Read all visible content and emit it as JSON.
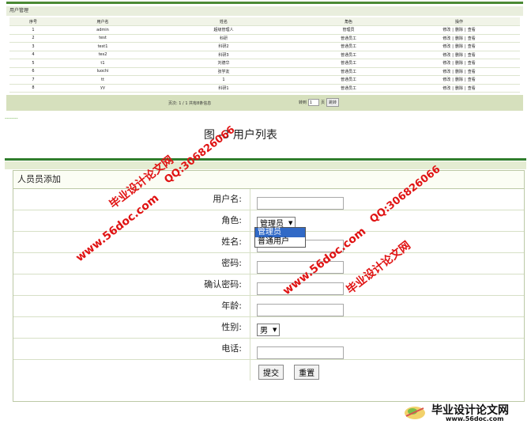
{
  "list": {
    "title": "用户管理",
    "columns": [
      "序号",
      "用户名",
      "姓名",
      "角色",
      "操作"
    ],
    "rows": [
      {
        "no": "1",
        "username": "admin",
        "name": "超级管理人",
        "role": "管理员",
        "ops": [
          "修改",
          "删除",
          "查看"
        ]
      },
      {
        "no": "2",
        "username": "test",
        "name": "科研",
        "role": "普通员工",
        "ops": [
          "修改",
          "删除",
          "查看"
        ]
      },
      {
        "no": "3",
        "username": "test1",
        "name": "科研2",
        "role": "普通员工",
        "ops": [
          "修改",
          "删除",
          "查看"
        ]
      },
      {
        "no": "4",
        "username": "tes2",
        "name": "科研3",
        "role": "普通员工",
        "ops": [
          "修改",
          "删除",
          "查看"
        ]
      },
      {
        "no": "5",
        "username": "t1",
        "name": "刘德华",
        "role": "普通员工",
        "ops": [
          "修改",
          "删除",
          "查看"
        ]
      },
      {
        "no": "6",
        "username": "Iuochi",
        "name": "张学友",
        "role": "普通员工",
        "ops": [
          "修改",
          "删除",
          "查看"
        ]
      },
      {
        "no": "7",
        "username": "tt",
        "name": "1",
        "role": "普通员工",
        "ops": [
          "修改",
          "删除",
          "查看"
        ]
      },
      {
        "no": "8",
        "username": "yy",
        "name": "科研1",
        "role": "普通员工",
        "ops": [
          "修改",
          "删除",
          "查看"
        ]
      }
    ],
    "pager": {
      "info": "页次: 1 / 1 共有8条信息",
      "goto_prefix": "转到",
      "goto_value": "1",
      "goto_suffix": "页",
      "goto_button": "跳转"
    }
  },
  "caption": "图 -3 用户列表",
  "form": {
    "title": "人员员添加",
    "fields": {
      "username_label": "用户名:",
      "role_label": "角色:",
      "role_value": "管理员",
      "role_options": [
        "管理员",
        "普通用户"
      ],
      "name_label": "姓名:",
      "password_label": "密码:",
      "confirm_label": "确认密码:",
      "age_label": "年龄:",
      "gender_label": "性别:",
      "gender_value": "男",
      "phone_label": "电话:"
    },
    "submit_label": "提交",
    "reset_label": "重置"
  },
  "watermarks": {
    "site_name": "毕业设计论文网",
    "qq": "QQ:306826066",
    "url": "www.56doc.com",
    "logo_url": "www.56doc.com"
  },
  "colors": {
    "accent_green": "#2f7d2c",
    "pager_bg": "#d6e0bd",
    "watermark_red": "#e01313",
    "select_highlight": "#3169c6"
  }
}
